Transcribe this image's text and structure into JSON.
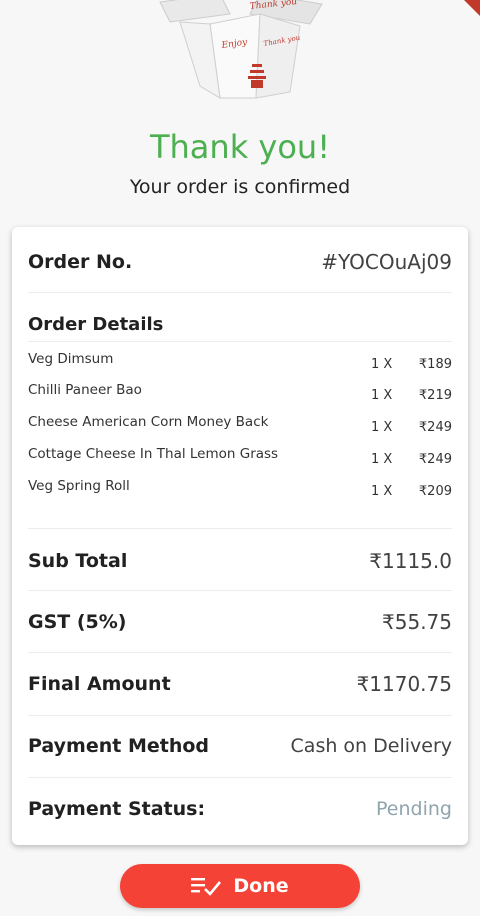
{
  "header": {
    "box_text_top": "Thank you",
    "box_text_left": "Enjoy",
    "box_text_right": "Thank you",
    "title": "Thank you!",
    "subtitle": "Your order is confirmed"
  },
  "colors": {
    "success": "#4caf50",
    "accent": "#f44336",
    "pending": "#90a4ae"
  },
  "order": {
    "label": "Order No.",
    "number": "#YOCOuAj09"
  },
  "details": {
    "label": "Order Details",
    "items": [
      {
        "name": "Veg Dimsum",
        "qty": "1 X",
        "price": "₹189"
      },
      {
        "name": "Chilli Paneer Bao",
        "qty": "1 X",
        "price": "₹219"
      },
      {
        "name": "Cheese American Corn Money Back",
        "qty": "1 X",
        "price": "₹249"
      },
      {
        "name": "Cottage Cheese In Thal Lemon Grass",
        "qty": "1 X",
        "price": "₹249"
      },
      {
        "name": "Veg Spring Roll",
        "qty": "1 X",
        "price": "₹209"
      }
    ]
  },
  "summary": {
    "subtotal_label": "Sub Total",
    "subtotal_value": "₹1115.0",
    "gst_label": "GST (5%)",
    "gst_value": "₹55.75",
    "final_label": "Final Amount",
    "final_value": "₹1170.75",
    "payment_method_label": "Payment Method",
    "payment_method_value": "Cash on Delivery",
    "payment_status_label": "Payment Status:",
    "payment_status_value": "Pending"
  },
  "actions": {
    "done_label": "Done",
    "done_icon": "list-check-icon"
  }
}
